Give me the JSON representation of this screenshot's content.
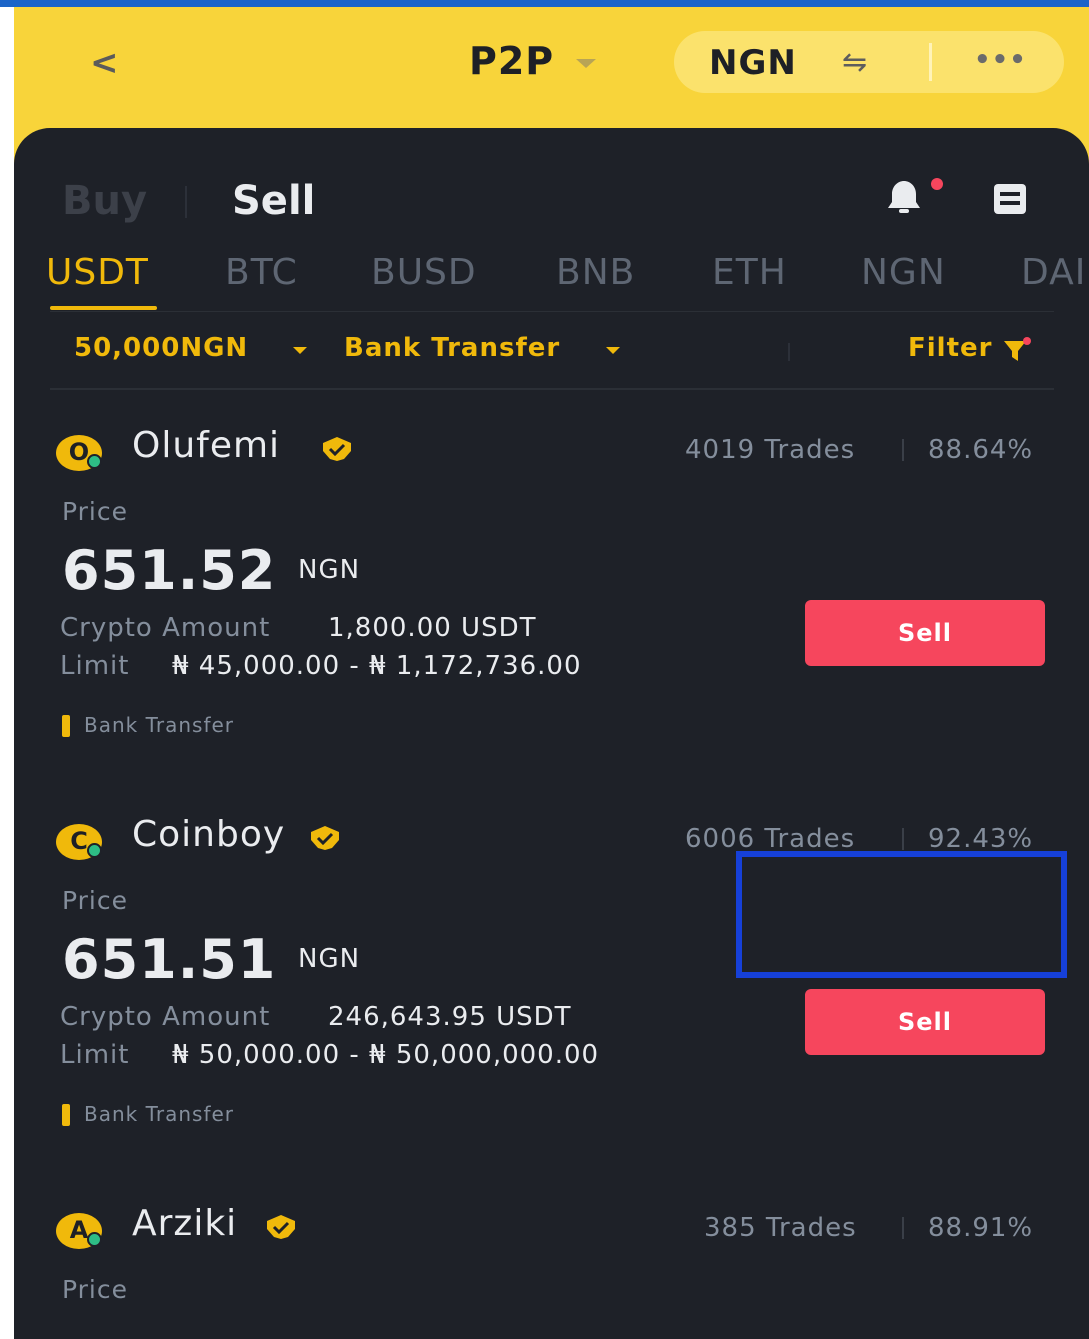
{
  "header": {
    "back_icon": "chevron-left-icon",
    "title": "P2P",
    "currency": "NGN",
    "swap_icon": "swap-arrows-icon",
    "more_icon": "more-dots-icon"
  },
  "segment": {
    "buy": "Buy",
    "sell": "Sell",
    "active": "Sell"
  },
  "icons": {
    "notifications": "bell-icon",
    "orders": "orders-list-icon"
  },
  "coin_tabs": [
    "USDT",
    "BTC",
    "BUSD",
    "BNB",
    "ETH",
    "NGN",
    "DAI"
  ],
  "active_coin": "USDT",
  "filters": {
    "amount": "50,000NGN",
    "payment": "Bank Transfer",
    "filter_label": "Filter"
  },
  "colors": {
    "brand_yellow": "#f8d43a",
    "accent": "#f0b90b",
    "sell": "#f6465d",
    "panel": "#1e2128",
    "highlight": "#1640d8"
  },
  "ads": [
    {
      "initial": "O",
      "merchant": "Olufemi",
      "trades": "4019 Trades",
      "completion": "88.64%",
      "price_label": "Price",
      "price": "651.52",
      "price_currency": "NGN",
      "amount_label": "Crypto Amount",
      "amount": "1,800.00 USDT",
      "limit_label": "Limit",
      "limit": "₦ 45,000.00 - ₦ 1,172,736.00",
      "payment": "Bank Transfer",
      "button": "Sell"
    },
    {
      "initial": "C",
      "merchant": "Coinboy",
      "trades": "6006 Trades",
      "completion": "92.43%",
      "price_label": "Price",
      "price": "651.51",
      "price_currency": "NGN",
      "amount_label": "Crypto Amount",
      "amount": "246,643.95 USDT",
      "limit_label": "Limit",
      "limit": "₦ 50,000.00 - ₦ 50,000,000.00",
      "payment": "Bank Transfer",
      "button": "Sell"
    },
    {
      "initial": "A",
      "merchant": "Arziki",
      "trades": "385 Trades",
      "completion": "88.91%",
      "price_label": "Price"
    }
  ]
}
